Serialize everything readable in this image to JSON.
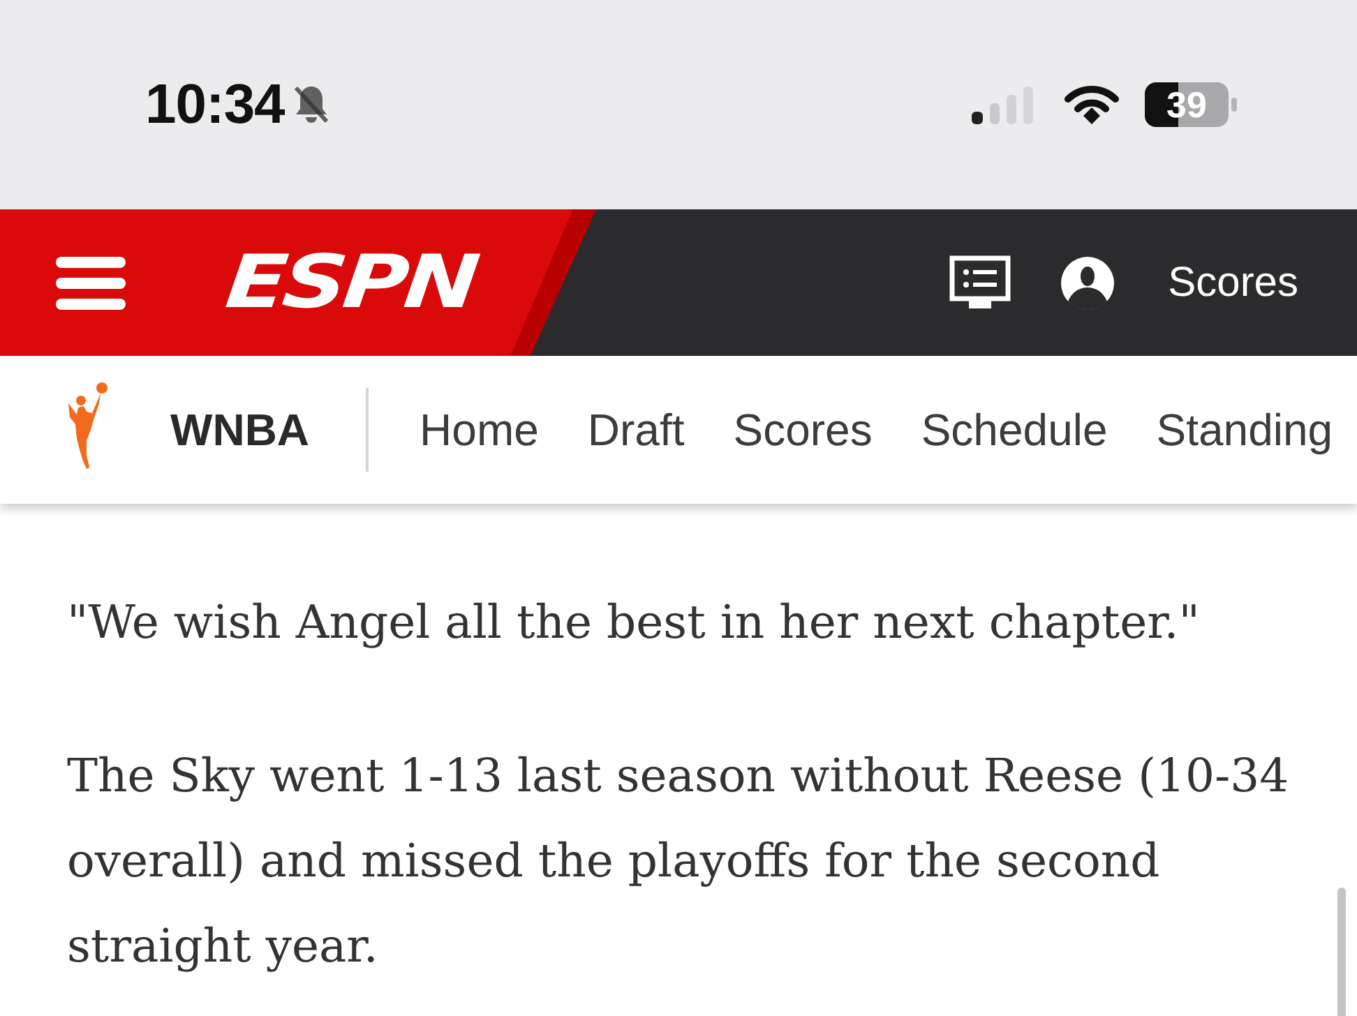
{
  "status_bar": {
    "time": "10:34",
    "battery": "39"
  },
  "header": {
    "logo": "ESPN",
    "scores_link": "Scores"
  },
  "league_nav": {
    "league": "WNBA",
    "tabs": [
      {
        "label": "Home"
      },
      {
        "label": "Draft"
      },
      {
        "label": "Scores"
      },
      {
        "label": "Schedule"
      },
      {
        "label": "Standing"
      }
    ]
  },
  "article": {
    "paragraphs": [
      "\"We wish Angel all the best in her next chapter.\"",
      "The Sky went 1-13 last season without Reese (10-34 overall) and missed the playoffs for the second straight year."
    ]
  }
}
